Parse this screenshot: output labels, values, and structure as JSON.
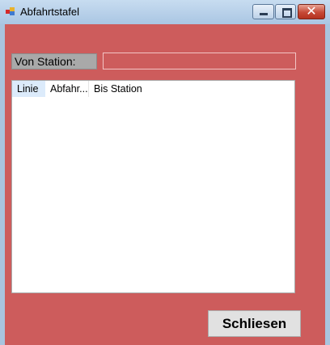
{
  "window": {
    "title": "Abfahrtstafel",
    "icon": "app-form-icon",
    "controls": {
      "minimize_icon": "minimize-icon",
      "maximize_icon": "maximize-icon",
      "close_icon": "close-icon",
      "close_glyph": "✕"
    }
  },
  "form": {
    "background_color": "#CD5C5C",
    "station_label": "Von Station:",
    "station_input": {
      "value": "",
      "placeholder": ""
    },
    "listview": {
      "columns": [
        "Linie",
        "Abfahr...",
        "Bis Station"
      ],
      "rows": []
    },
    "close_button_label": "Schliesen"
  }
}
